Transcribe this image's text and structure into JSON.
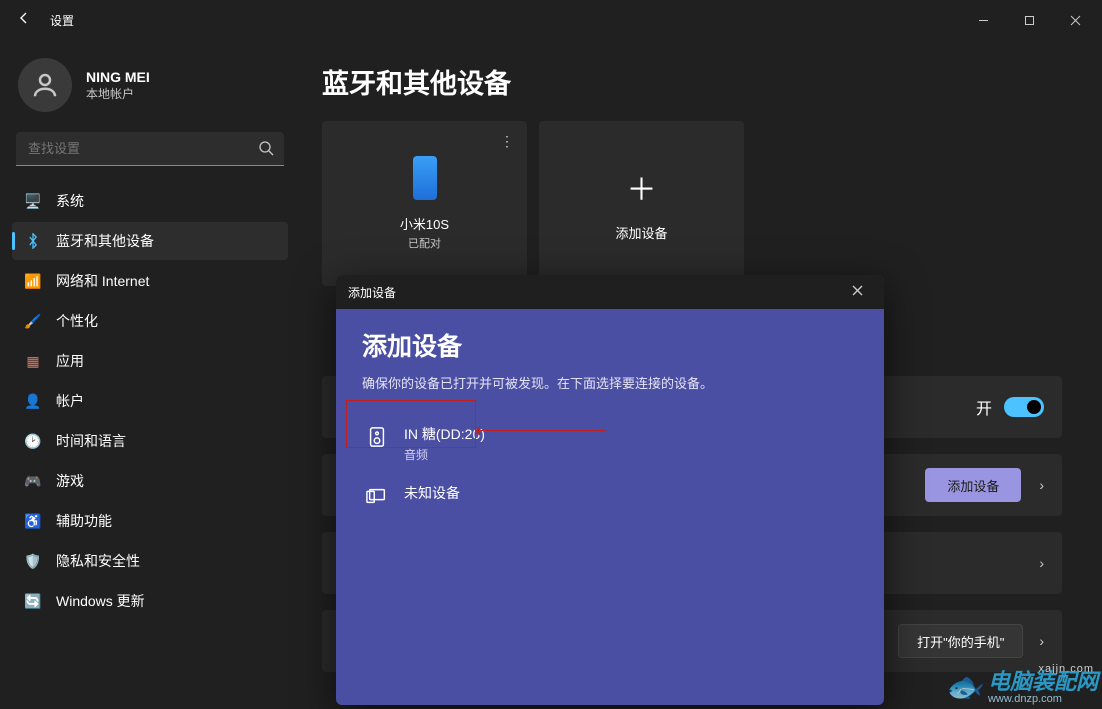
{
  "app": {
    "title": "设置"
  },
  "profile": {
    "name": "NING MEI",
    "sub": "本地帐户"
  },
  "search": {
    "placeholder": "查找设置"
  },
  "nav": [
    {
      "key": "system",
      "label": "系统",
      "icon": "🖥️",
      "selected": false
    },
    {
      "key": "bluetooth",
      "label": "蓝牙和其他设备",
      "icon": "bt",
      "selected": true
    },
    {
      "key": "network",
      "label": "网络和 Internet",
      "icon": "📶",
      "selected": false
    },
    {
      "key": "personalization",
      "label": "个性化",
      "icon": "🖌️",
      "selected": false
    },
    {
      "key": "apps",
      "label": "应用",
      "icon": "▦",
      "selected": false
    },
    {
      "key": "accounts",
      "label": "帐户",
      "icon": "👤",
      "selected": false
    },
    {
      "key": "timelang",
      "label": "时间和语言",
      "icon": "🕑",
      "selected": false
    },
    {
      "key": "gaming",
      "label": "游戏",
      "icon": "🎮",
      "selected": false
    },
    {
      "key": "accessibility",
      "label": "辅助功能",
      "icon": "♿",
      "selected": false
    },
    {
      "key": "privacy",
      "label": "隐私和安全性",
      "icon": "🛡️",
      "selected": false
    },
    {
      "key": "update",
      "label": "Windows 更新",
      "icon": "🔄",
      "selected": false
    }
  ],
  "page": {
    "title": "蓝牙和其他设备"
  },
  "cards": {
    "device": {
      "title": "小米10S",
      "sub": "已配对"
    },
    "add": {
      "title": "添加设备"
    }
  },
  "bluetooth_toggle": {
    "label": "开",
    "state": true
  },
  "add_button": {
    "label": "添加设备"
  },
  "yourphone": {
    "label": "打开\"你的手机\""
  },
  "dialog": {
    "header": "添加设备",
    "title": "添加设备",
    "desc": "确保你的设备已打开并可被发现。在下面选择要连接的设备。",
    "devices": [
      {
        "name": "IN 糖(DD:20)",
        "sub": "音频",
        "icon": "speaker"
      },
      {
        "name": "未知设备",
        "sub": "",
        "icon": "display"
      }
    ]
  },
  "watermark": {
    "top": "xajjn.com",
    "main": "电脑装配网",
    "url": "www.dnzp.com"
  }
}
